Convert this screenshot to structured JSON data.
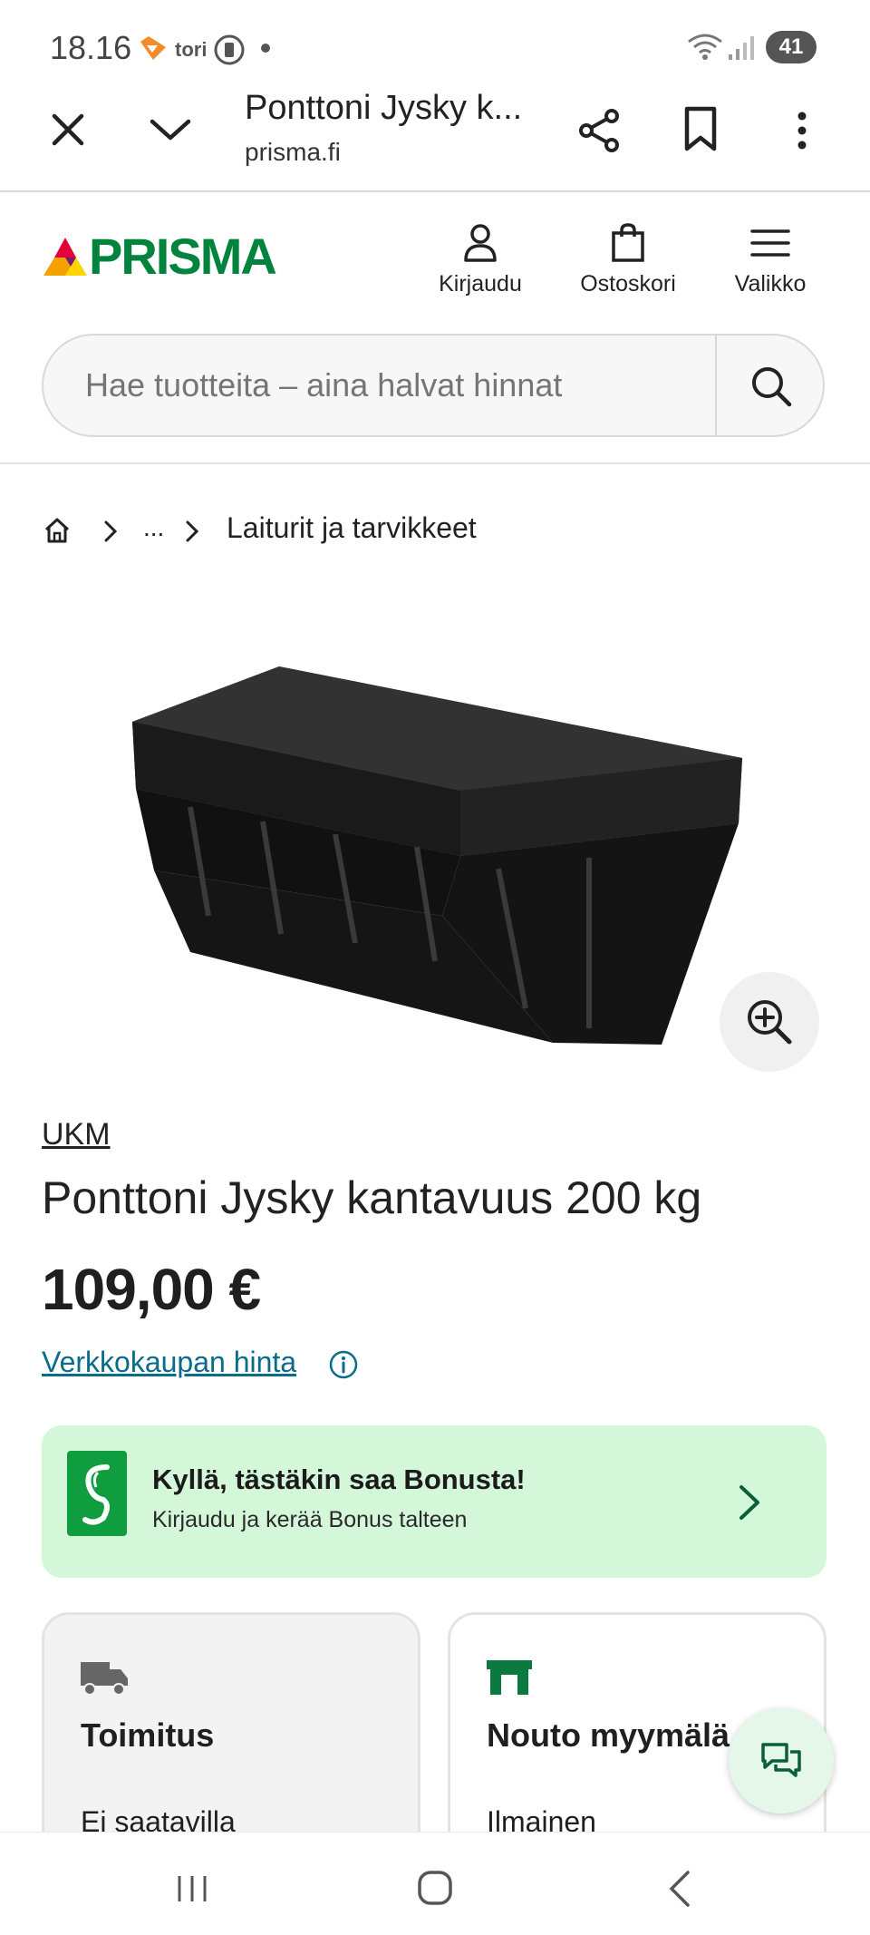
{
  "status_bar": {
    "time": "18.16",
    "notification_app": "tori",
    "battery": "41"
  },
  "browser": {
    "tab_title": "Ponttoni Jysky k...",
    "url": "prisma.fi"
  },
  "header": {
    "logo_text": "PRISMA",
    "login_label": "Kirjaudu",
    "cart_label": "Ostoskori",
    "menu_label": "Valikko"
  },
  "search": {
    "placeholder": "Hae tuotteita – aina halvat hinnat"
  },
  "breadcrumb": {
    "ellipsis": "...",
    "current": "Laiturit ja tarvikkeet"
  },
  "product": {
    "brand": "UKM",
    "title": "Ponttoni Jysky kantavuus 200 kg",
    "price": "109,00 €",
    "price_note": "Verkkokaupan hinta"
  },
  "bonus": {
    "title": "Kyllä, tästäkin saa Bonusta!",
    "subtitle": "Kirjaudu ja kerää Bonus talteen"
  },
  "cards": {
    "delivery": {
      "title": "Toimitus",
      "subtitle": "Ei saatavilla"
    },
    "pickup": {
      "title": "Nouto myymälä",
      "subtitle": "Ilmainen"
    }
  },
  "colors": {
    "brand_green": "#00843d",
    "bonus_bg": "#d5f7d9",
    "link_blue": "#0a6b8a"
  },
  "icons": [
    "close-icon",
    "chevron-down-icon",
    "share-icon",
    "bookmark-icon",
    "more-vert-icon",
    "user-icon",
    "shopping-bag-icon",
    "hamburger-icon",
    "search-icon",
    "home-icon",
    "chevron-right-icon",
    "zoom-in-icon",
    "info-icon",
    "truck-icon",
    "store-icon",
    "chat-icon"
  ]
}
